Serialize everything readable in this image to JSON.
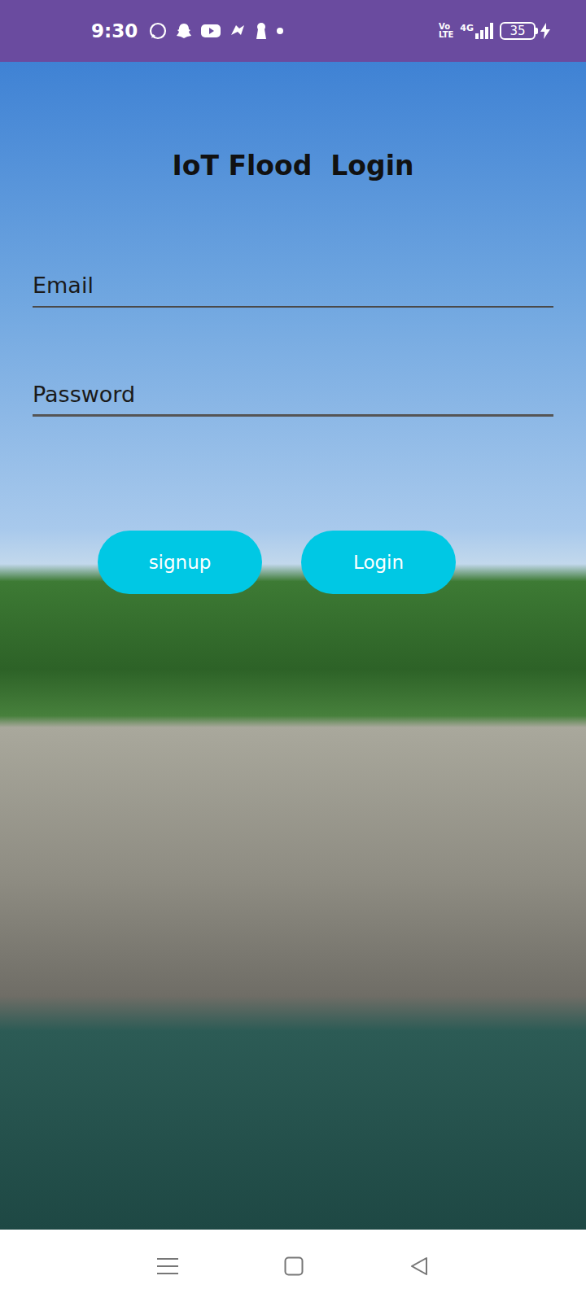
{
  "status_bar": {
    "time": "9:30",
    "volte": [
      "Vo",
      "LTE"
    ],
    "network": "4G",
    "battery": "35"
  },
  "title": "IoT Flood  Login",
  "fields": [
    {
      "placeholder": "Email"
    },
    {
      "placeholder": "Password"
    }
  ],
  "buttons": [
    "signup",
    "Login"
  ]
}
